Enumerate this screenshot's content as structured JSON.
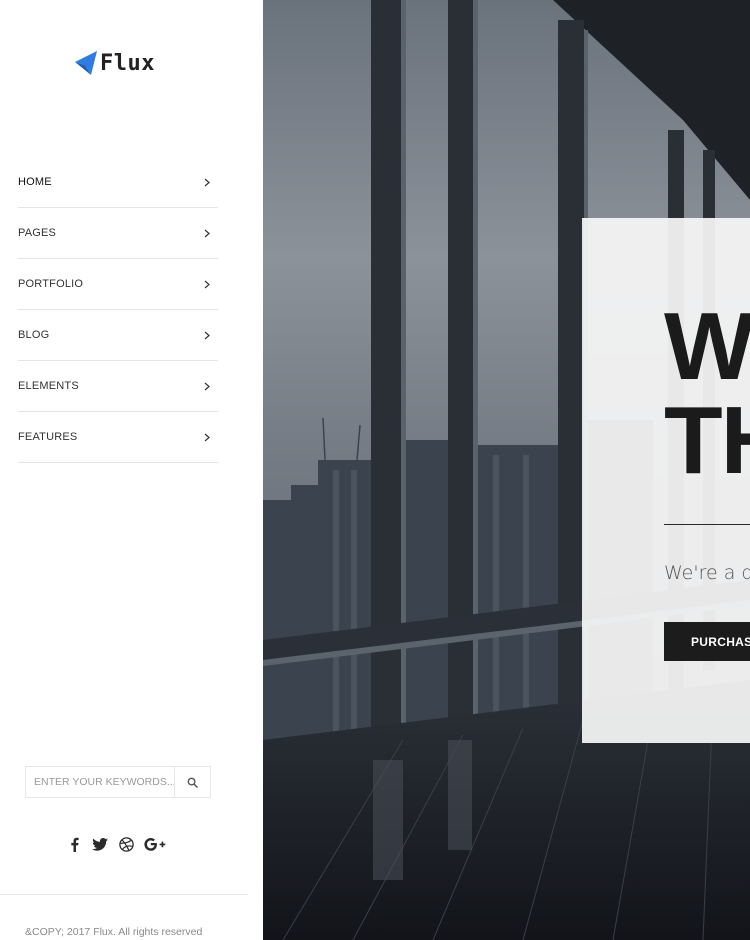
{
  "brand": {
    "name": "Flux",
    "accent": "#2f7de1"
  },
  "nav": {
    "items": [
      {
        "label": "HOME"
      },
      {
        "label": "PAGES"
      },
      {
        "label": "PORTFOLIO"
      },
      {
        "label": "BLOG"
      },
      {
        "label": "ELEMENTS"
      },
      {
        "label": "FEATURES"
      }
    ]
  },
  "search": {
    "placeholder": "ENTER YOUR KEYWORDS..."
  },
  "social": {
    "icons": [
      "facebook-icon",
      "twitter-icon",
      "dribbble-icon",
      "google-plus-icon"
    ]
  },
  "footer": {
    "copyright": "&COPY; 2017 Flux. All rights reserved"
  },
  "hero": {
    "title": "W\nTH",
    "subtitle": "We're a de",
    "button_label": "PURCHAS",
    "card_color": "#f6f6f6",
    "button_color": "#1c1c1c"
  }
}
